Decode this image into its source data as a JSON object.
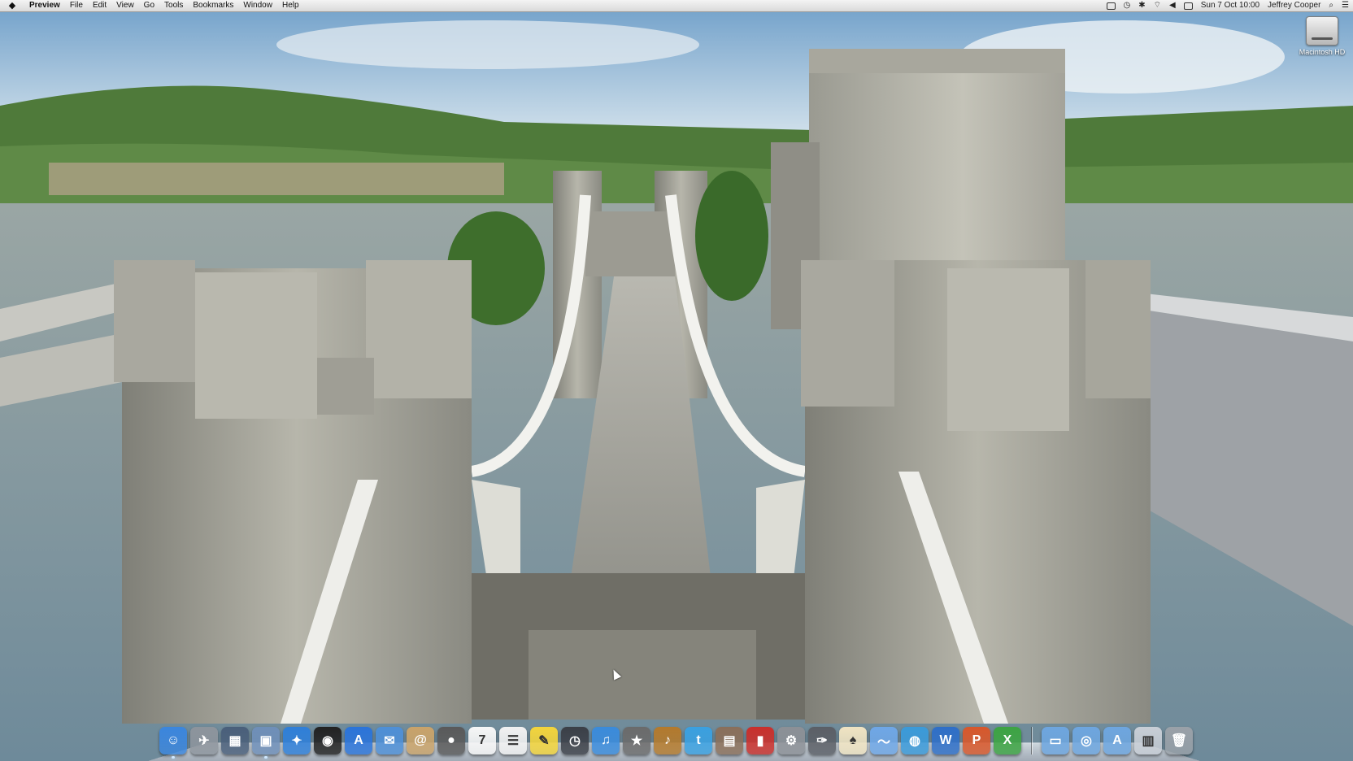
{
  "menubar": {
    "apple_symbol": "",
    "app_name": "Preview",
    "menus": [
      "File",
      "Edit",
      "View",
      "Go",
      "Tools",
      "Bookmarks",
      "Window",
      "Help"
    ],
    "datetime": "Sun 7 Oct  10:00",
    "user": "Jeffrey Cooper",
    "status_icons": [
      "airplay-icon",
      "time-machine-icon",
      "bluetooth-icon",
      "wifi-icon",
      "volume-icon",
      "flag-icon"
    ]
  },
  "desktop": {
    "hd_label": "Macintosh HD"
  },
  "dock": {
    "apps": [
      {
        "icon": "finder-icon",
        "glyph": "☺",
        "color": "#3b86dd",
        "running": true
      },
      {
        "icon": "launchpad-icon",
        "glyph": "✈",
        "color": "#8d949c",
        "running": false
      },
      {
        "icon": "mission-control-icon",
        "glyph": "▦",
        "color": "#4a5f7a",
        "running": false
      },
      {
        "icon": "preview-icon",
        "glyph": "▣",
        "color": "#6f8fb8",
        "running": true
      },
      {
        "icon": "safari-icon",
        "glyph": "✦",
        "color": "#2f7fd8",
        "running": false
      },
      {
        "icon": "aperture-icon",
        "glyph": "◉",
        "color": "#222222",
        "running": false
      },
      {
        "icon": "app-store-icon",
        "glyph": "A",
        "color": "#2b74d9",
        "running": false
      },
      {
        "icon": "mail-icon",
        "glyph": "✉",
        "color": "#4e8fd6",
        "running": false
      },
      {
        "icon": "contacts-icon",
        "glyph": "@",
        "color": "#c9a36a",
        "running": false
      },
      {
        "icon": "facetime-icon",
        "glyph": "●",
        "color": "#5a5a5a",
        "running": false
      },
      {
        "icon": "calendar-icon",
        "glyph": "7",
        "color": "#f6f6f6",
        "running": false
      },
      {
        "icon": "reminders-icon",
        "glyph": "☰",
        "color": "#f1f1f1",
        "running": false
      },
      {
        "icon": "stickies-icon",
        "glyph": "✎",
        "color": "#f2d43c",
        "running": false
      },
      {
        "icon": "time-machine-icon",
        "glyph": "◷",
        "color": "#3b3f47",
        "running": false
      },
      {
        "icon": "itunes-icon",
        "glyph": "♫",
        "color": "#3a8bdb",
        "running": false
      },
      {
        "icon": "imovie-icon",
        "glyph": "★",
        "color": "#6b6b6b",
        "running": false
      },
      {
        "icon": "garageband-icon",
        "glyph": "♪",
        "color": "#b37a2d",
        "running": false
      },
      {
        "icon": "twitter-icon",
        "glyph": "t",
        "color": "#3aa0e0",
        "running": false
      },
      {
        "icon": "photo-booth-icon",
        "glyph": "▤",
        "color": "#8a6f5a",
        "running": false
      },
      {
        "icon": "photo-booth-red-icon",
        "glyph": "▮",
        "color": "#c9302c",
        "running": false
      },
      {
        "icon": "system-preferences-icon",
        "glyph": "⚙",
        "color": "#8c9096",
        "running": false
      },
      {
        "icon": "script-editor-icon",
        "glyph": "✑",
        "color": "#5b5f66",
        "running": false
      },
      {
        "icon": "solitaire-icon",
        "glyph": "♠",
        "color": "#efe3c2",
        "running": false
      },
      {
        "icon": "feather-app-icon",
        "glyph": "〜",
        "color": "#6fa7e6",
        "running": false
      },
      {
        "icon": "network-utility-icon",
        "glyph": "◍",
        "color": "#3b9ad9",
        "running": false
      },
      {
        "icon": "word-icon",
        "glyph": "W",
        "color": "#2f6fc7",
        "running": false
      },
      {
        "icon": "powerpoint-icon",
        "glyph": "P",
        "color": "#d8582b",
        "running": false
      },
      {
        "icon": "excel-icon",
        "glyph": "X",
        "color": "#3da443",
        "running": false
      }
    ],
    "stacks": [
      {
        "icon": "applications-folder-icon",
        "glyph": "▭",
        "color": "#6ea6df"
      },
      {
        "icon": "documents-folder-icon",
        "glyph": "◎",
        "color": "#6ea6df"
      },
      {
        "icon": "apps-stack-icon",
        "glyph": "A",
        "color": "#6ea6df"
      },
      {
        "icon": "downloads-stack-icon",
        "glyph": "▥",
        "color": "#c8ced6"
      },
      {
        "icon": "trash-icon",
        "glyph": "🗑",
        "color": "#9aa1a8"
      }
    ]
  }
}
